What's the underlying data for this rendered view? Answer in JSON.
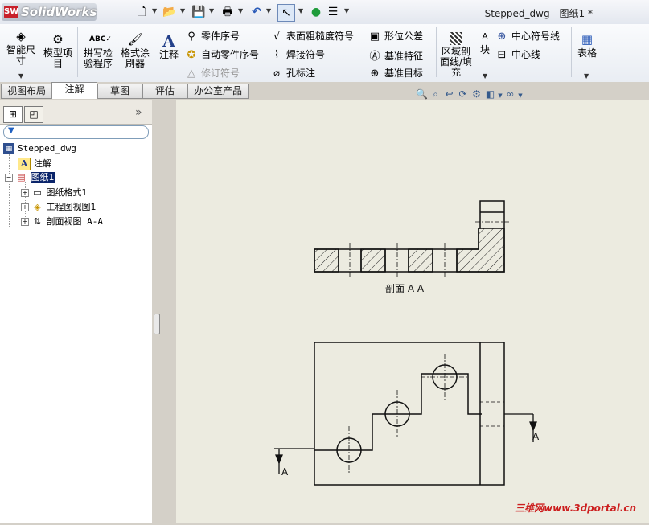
{
  "app": {
    "name": "SolidWorks",
    "doc_title": "Stepped_dwg - 图纸1 *"
  },
  "ribbon": {
    "smart_dim": "智能尺寸",
    "model_items": "模型项目",
    "spell_check": "拼写检验程序",
    "format_painter": "格式涂刷器",
    "note": "注释",
    "balloon": "零件序号",
    "auto_balloon": "自动零件序号",
    "revision_symbol": "修订符号",
    "surface_finish": "表面粗糙度符号",
    "weld_symbol": "焊接符号",
    "hole_callout": "孔标注",
    "gtol": "形位公差",
    "datum_feature": "基准特征",
    "datum_target": "基准目标",
    "area_hatch": "区域剖面线/填充",
    "block": "块",
    "center_mark": "中心符号线",
    "centerline": "中心线",
    "tables": "表格"
  },
  "tabs": [
    "视图布局",
    "注解",
    "草图",
    "评估",
    "办公室产品"
  ],
  "active_tab": "注解",
  "tree": {
    "root": "Stepped_dwg",
    "annotations": "注解",
    "sheet": "图纸1",
    "sheet_format": "图纸格式1",
    "drawing_view": "工程图视图1",
    "section_view": "剖面视图 A-A"
  },
  "drawing": {
    "section_label": "剖面 A-A",
    "arrow_label_left": "A",
    "arrow_label_right": "A"
  },
  "watermark": "三维网www.3dportal.cn",
  "colors": {
    "canvas": "#ecebe0",
    "panel": "#ffffff",
    "ribbon": "#eef1f6",
    "selection": "#0a246a"
  }
}
